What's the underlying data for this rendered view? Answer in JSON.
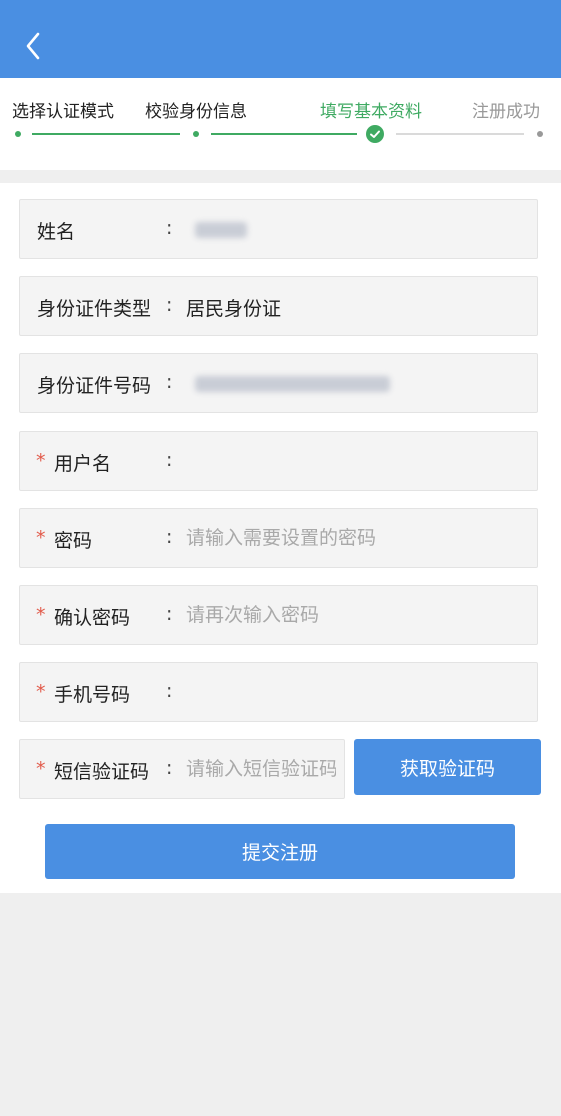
{
  "header": {
    "back_icon": "chevron-left-icon",
    "color": "#4a8fe2"
  },
  "steps": [
    {
      "label": "选择认证模式",
      "state": "done"
    },
    {
      "label": "校验身份信息",
      "state": "done"
    },
    {
      "label": "填写基本资料",
      "state": "current"
    },
    {
      "label": "注册成功",
      "state": "todo"
    }
  ],
  "form": {
    "name": {
      "label": "姓名",
      "colon": ":",
      "value_hidden": true
    },
    "id_type": {
      "label": "身份证件类型",
      "colon": ":",
      "value": "居民身份证"
    },
    "id_number": {
      "label": "身份证件号码",
      "colon": ":",
      "value_hidden": true
    },
    "username": {
      "required_mark": "*",
      "label": "用户名",
      "colon": ":",
      "value": "",
      "placeholder": ""
    },
    "password": {
      "required_mark": "*",
      "label": "密码",
      "colon": ":",
      "value": "",
      "placeholder": "请输入需要设置的密码"
    },
    "confirm_password": {
      "required_mark": "*",
      "label": "确认密码",
      "colon": ":",
      "value": "",
      "placeholder": "请再次输入密码"
    },
    "phone": {
      "required_mark": "*",
      "label": "手机号码",
      "colon": ":",
      "value": "",
      "placeholder": ""
    },
    "sms_code": {
      "required_mark": "*",
      "label": "短信验证码",
      "colon": ":",
      "value": "",
      "placeholder": "请输入短信验证码"
    },
    "get_code_label": "获取验证码",
    "submit_label": "提交注册"
  },
  "colors": {
    "primary": "#4a8fe2",
    "success": "#3faa62",
    "required": "#e25a4a"
  }
}
